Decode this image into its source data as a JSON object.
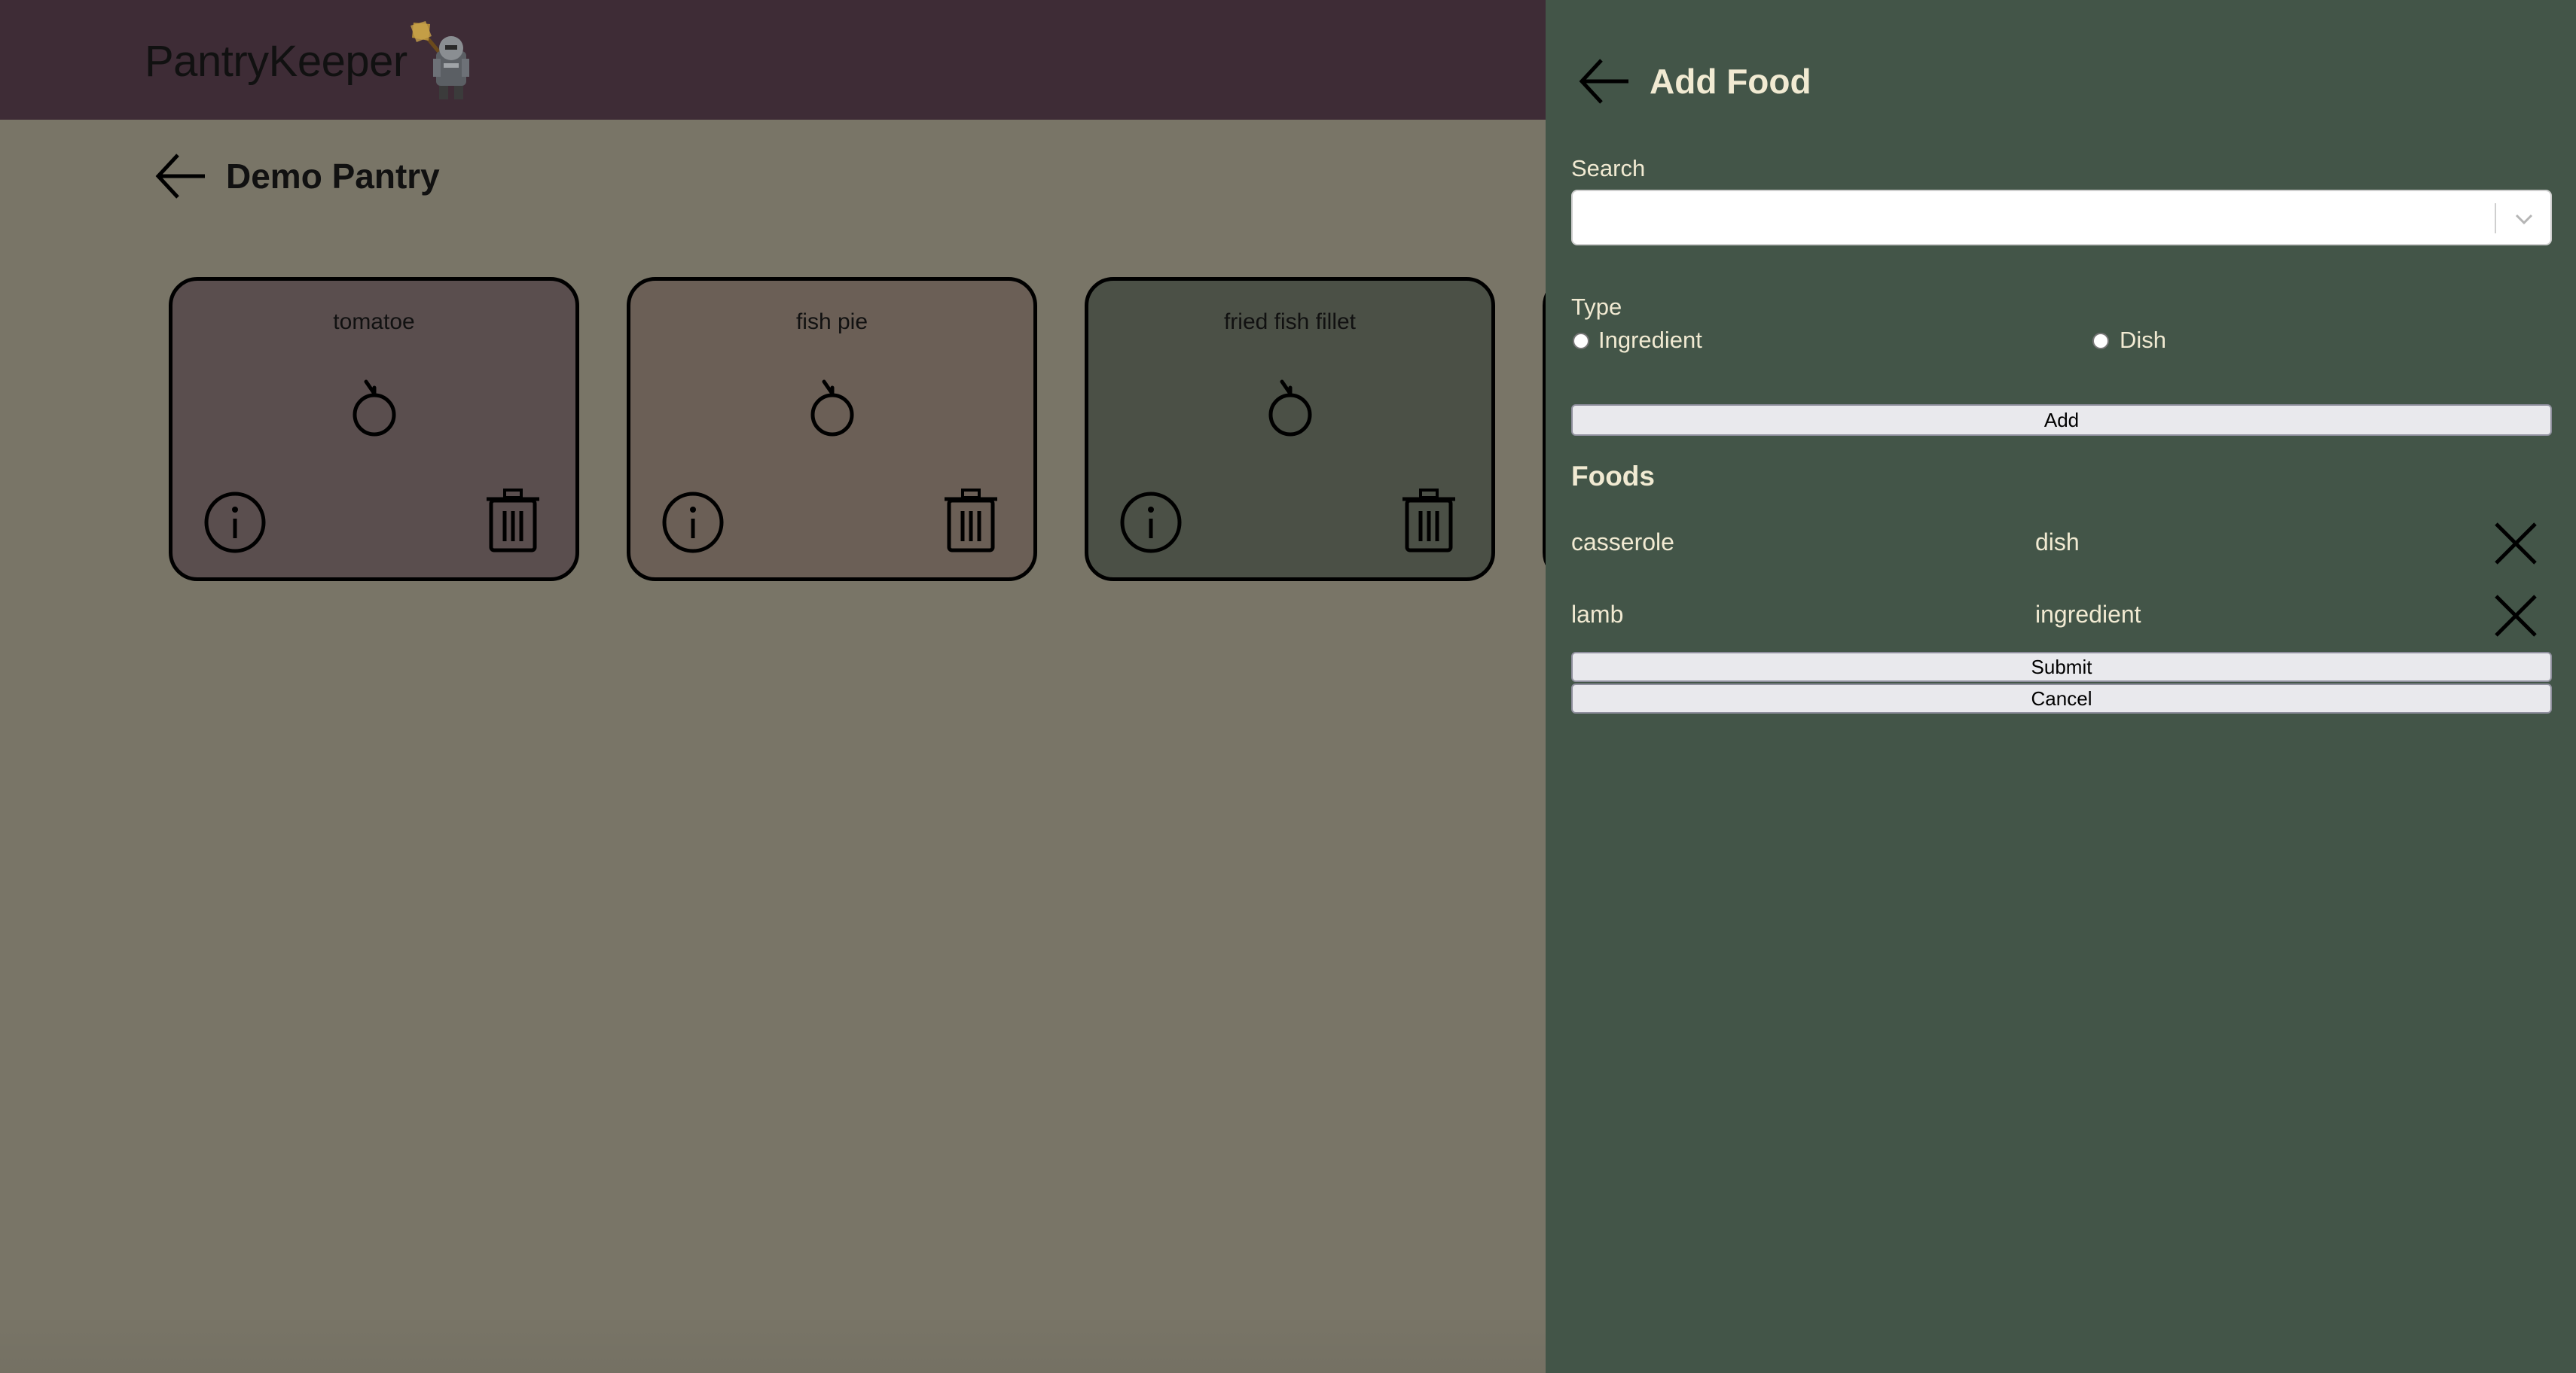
{
  "app": {
    "brand_name": "PantryKeeper"
  },
  "pantry": {
    "title": "Demo Pantry",
    "items": [
      {
        "name": "tomatoe",
        "color": "#5a4e4e"
      },
      {
        "name": "fish pie",
        "color": "#6b5f56"
      },
      {
        "name": "fried fish fillet",
        "color": "#4b5046"
      }
    ]
  },
  "drawer": {
    "title": "Add Food",
    "search_label": "Search",
    "search_value": "",
    "type_label": "Type",
    "type_options": [
      "Ingredient",
      "Dish"
    ],
    "add_label": "Add",
    "foods_heading": "Foods",
    "foods": [
      {
        "name": "casserole",
        "type": "dish"
      },
      {
        "name": "lamb",
        "type": "ingredient"
      }
    ],
    "submit_label": "Submit",
    "cancel_label": "Cancel"
  },
  "colors": {
    "header": "#3e2c36",
    "background": "#797567",
    "drawer": "#435548",
    "drawer_text": "#f1ead2"
  }
}
